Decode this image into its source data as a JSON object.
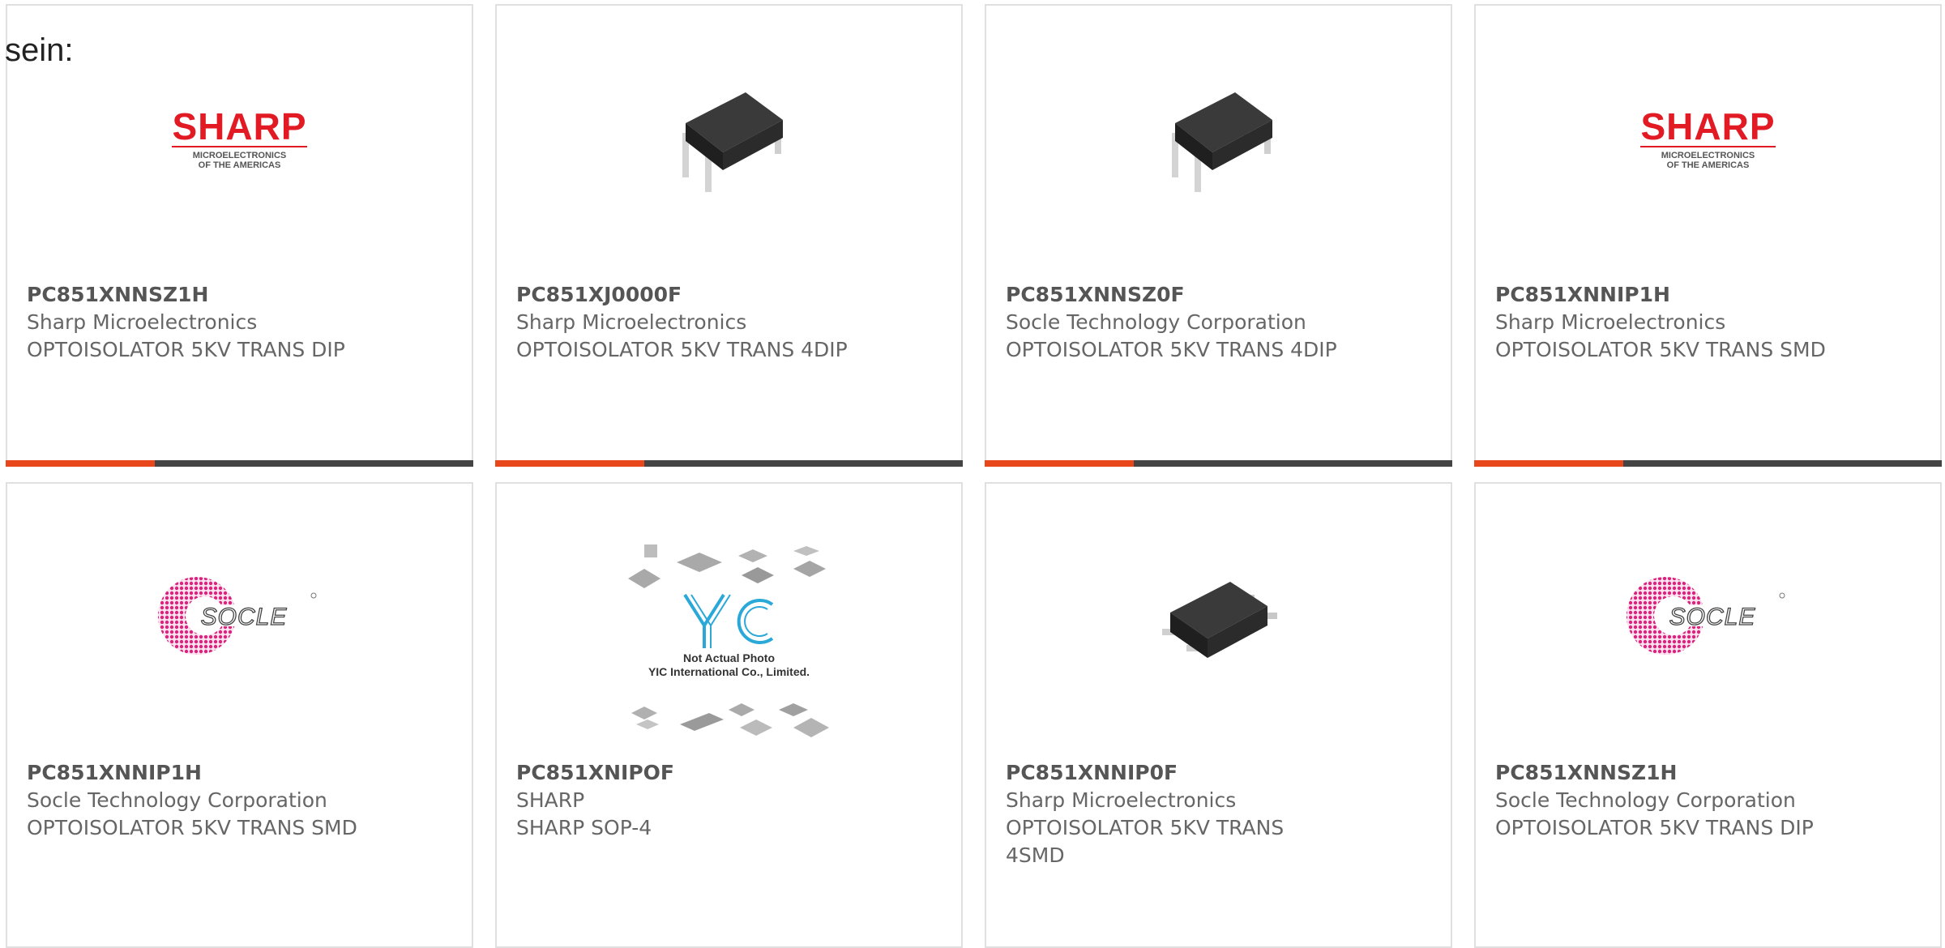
{
  "lead_text": "sein:",
  "colors": {
    "accent_orange": "#e8471c",
    "bar_dark": "#444444",
    "sharp_red": "#e21a23",
    "socle_magenta": "#d6257e"
  },
  "products": [
    {
      "part_no": "PC851XNNSZ1H",
      "maker": "Sharp Microelectronics",
      "description": "OPTOISOLATOR 5KV TRANS DIP",
      "image": "sharp-logo",
      "logo_text": "SHARP",
      "logo_sub1": "MICROELECTRONICS",
      "logo_sub2": "OF THE AMERICAS"
    },
    {
      "part_no": "PC851XJ0000F",
      "maker": "Sharp Microelectronics",
      "description": "OPTOISOLATOR 5KV TRANS 4DIP",
      "image": "dip-chip-photo"
    },
    {
      "part_no": "PC851XNNSZ0F",
      "maker": "Socle Technology Corporation",
      "description": "OPTOISOLATOR 5KV TRANS 4DIP",
      "image": "dip-chip-photo"
    },
    {
      "part_no": "PC851XNNIP1H",
      "maker": "Sharp Microelectronics",
      "description": "OPTOISOLATOR 5KV TRANS SMD",
      "image": "sharp-logo",
      "logo_text": "SHARP",
      "logo_sub1": "MICROELECTRONICS",
      "logo_sub2": "OF THE AMERICAS"
    },
    {
      "part_no": "PC851XNNIP1H",
      "maker": "Socle Technology Corporation",
      "description": "OPTOISOLATOR 5KV TRANS SMD",
      "image": "socle-logo",
      "logo_text": "SOCLE"
    },
    {
      "part_no": "PC851XNIPOF",
      "maker": "SHARP",
      "description": "SHARP SOP-4",
      "image": "yic-placeholder",
      "caption1": "Not Actual Photo",
      "caption2": "YIC International Co., Limited."
    },
    {
      "part_no": "PC851XNNIP0F",
      "maker": "Sharp Microelectronics",
      "description": "OPTOISOLATOR 5KV TRANS 4SMD",
      "image": "smd-chip-photo"
    },
    {
      "part_no": "PC851XNNSZ1H",
      "maker": "Socle Technology Corporation",
      "description": "OPTOISOLATOR 5KV TRANS DIP",
      "image": "socle-logo",
      "logo_text": "SOCLE"
    }
  ]
}
